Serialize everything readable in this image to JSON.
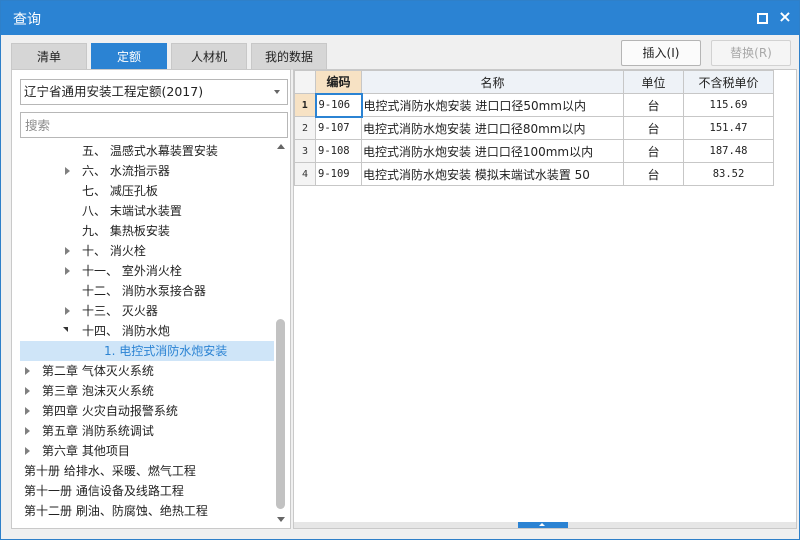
{
  "window": {
    "title": "查询",
    "maximize_icon": "maximize-icon",
    "close_icon": "close-icon",
    "close_glyph": "×"
  },
  "tabs": [
    {
      "label": "清单",
      "active": false
    },
    {
      "label": "定额",
      "active": true
    },
    {
      "label": "人材机",
      "active": false
    },
    {
      "label": "我的数据",
      "active": false
    }
  ],
  "toolbar": {
    "insert_label": "插入(I)",
    "replace_label": "替换(R)"
  },
  "library": {
    "selected": "辽宁省通用安装工程定额(2017)"
  },
  "search": {
    "placeholder": "搜索",
    "value": ""
  },
  "tree": [
    {
      "label": "五、 温感式水幕装置安装",
      "arrow": "none"
    },
    {
      "label": "六、 水流指示器",
      "arrow": "collapsed"
    },
    {
      "label": "七、 减压孔板",
      "arrow": "none"
    },
    {
      "label": "八、 末端试水装置",
      "arrow": "none"
    },
    {
      "label": "九、 集热板安装",
      "arrow": "none"
    },
    {
      "label": "十、 消火栓",
      "arrow": "collapsed"
    },
    {
      "label": "十一、 室外消火栓",
      "arrow": "collapsed"
    },
    {
      "label": "十二、 消防水泵接合器",
      "arrow": "none"
    },
    {
      "label": "十三、 灭火器",
      "arrow": "collapsed"
    },
    {
      "label": "十四、 消防水炮",
      "arrow": "expanded"
    },
    {
      "label": "1. 电控式消防水炮安装",
      "arrow": "none",
      "selected": true
    },
    {
      "label": "第二章 气体灭火系统",
      "arrow": "collapsed"
    },
    {
      "label": "第三章 泡沫灭火系统",
      "arrow": "collapsed"
    },
    {
      "label": "第四章 火灾自动报警系统",
      "arrow": "collapsed"
    },
    {
      "label": "第五章 消防系统调试",
      "arrow": "collapsed"
    },
    {
      "label": "第六章 其他项目",
      "arrow": "collapsed"
    },
    {
      "label": "第十册 给排水、采暖、燃气工程",
      "arrow": "collapsed"
    },
    {
      "label": "第十一册 通信设备及线路工程",
      "arrow": "collapsed"
    },
    {
      "label": "第十二册 刷油、防腐蚀、绝热工程",
      "arrow": "collapsed"
    }
  ],
  "table": {
    "columns": {
      "code": "编码",
      "name": "名称",
      "unit": "单位",
      "price": "不含税单价"
    },
    "rows": [
      {
        "num": "1",
        "code": "9-106",
        "name": "电控式消防水炮安装 进口口径50mm以内",
        "unit": "台",
        "price": "115.69"
      },
      {
        "num": "2",
        "code": "9-107",
        "name": "电控式消防水炮安装 进口口径80mm以内",
        "unit": "台",
        "price": "151.47"
      },
      {
        "num": "3",
        "code": "9-108",
        "name": "电控式消防水炮安装 进口口径100mm以内",
        "unit": "台",
        "price": "187.48"
      },
      {
        "num": "4",
        "code": "9-109",
        "name": "电控式消防水炮安装 模拟末端试水装置 50",
        "unit": "台",
        "price": "83.52"
      }
    ]
  },
  "colors": {
    "accent": "#2b83d3",
    "selected_bg": "#cfe5f8",
    "header_highlight": "#f7e2c4"
  }
}
